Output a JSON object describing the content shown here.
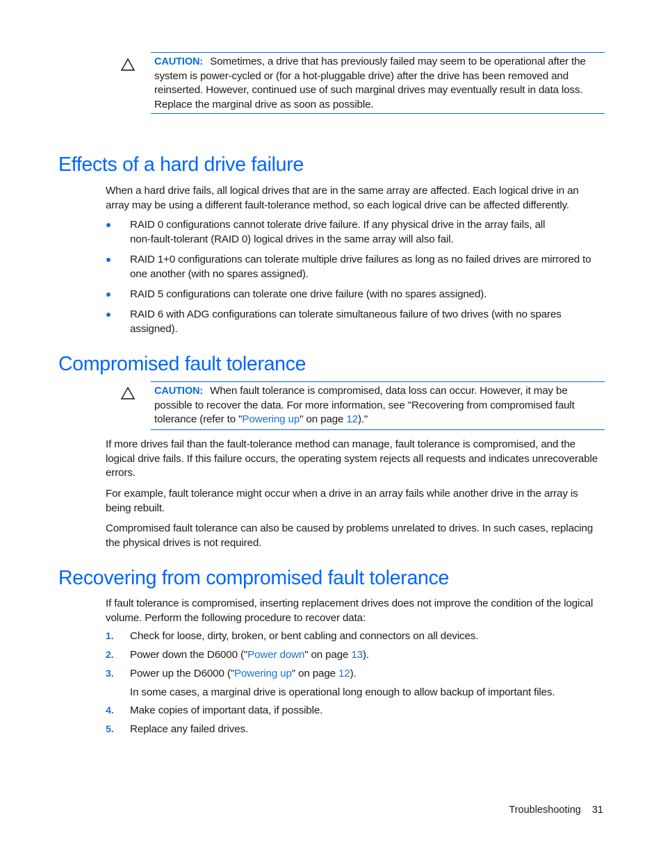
{
  "caution1": {
    "label": "CAUTION:",
    "text": "Sometimes, a drive that has previously failed may seem to be operational after the system is power-cycled or (for a hot-pluggable drive) after the drive has been removed and reinserted. However, continued use of such marginal drives may eventually result in data loss. Replace the marginal drive as soon as possible.",
    "lines": [
      "Sometimes, a drive that has previously failed may seem to be operational after the",
      "system is power-cycled or (for a hot-pluggable drive) after the drive has been removed and",
      "reinserted. However, continued use of such marginal drives may eventually result in data loss.",
      "Replace the marginal drive as soon as possible."
    ]
  },
  "section1": {
    "title": "Effects of a hard drive failure",
    "intro_lines": [
      "When a hard drive fails, all logical drives that are in the same array are affected. Each logical drive in an",
      "array may be using a different fault-tolerance method, so each logical drive can be affected differently."
    ],
    "bullets": [
      {
        "lines": [
          "RAID 0 configurations cannot tolerate drive failure. If any physical drive in the array fails, all",
          "non-fault-tolerant (RAID 0) logical drives in the same array will also fail."
        ]
      },
      {
        "lines": [
          "RAID 1+0 configurations can tolerate multiple drive failures as long as no failed drives are mirrored to",
          "one another (with no spares assigned)."
        ]
      },
      {
        "lines": [
          "RAID 5 configurations can tolerate one drive failure (with no spares assigned)."
        ]
      },
      {
        "lines": [
          "RAID 6 with ADG configurations can tolerate simultaneous failure of two drives (with no spares",
          "assigned)."
        ]
      }
    ]
  },
  "section2": {
    "title": "Compromised fault tolerance",
    "caution": {
      "label": "CAUTION:",
      "line1": "When fault tolerance is compromised, data loss can occur. However, it may be",
      "line2": "possible to recover the data. For more information, see \"Recovering from compromised fault",
      "line3_pre": "tolerance (refer to \"",
      "line3_link": "Powering up",
      "line3_mid": "\" on page ",
      "line3_page": "12",
      "line3_post": ").\""
    },
    "paragraphs": [
      [
        "If more drives fail than the fault-tolerance method can manage, fault tolerance is compromised, and the",
        "logical drive fails. If this failure occurs, the operating system rejects all requests and indicates unrecoverable",
        "errors."
      ],
      [
        "For example, fault tolerance might occur when a drive in an array fails while another drive in the array is",
        "being rebuilt."
      ],
      [
        "Compromised fault tolerance can also be caused by problems unrelated to drives. In such cases, replacing",
        "the physical drives is not required."
      ]
    ]
  },
  "section3": {
    "title": "Recovering from compromised fault tolerance",
    "intro_lines": [
      "If fault tolerance is compromised, inserting replacement drives does not improve the condition of the logical",
      "volume. Perform the following procedure to recover data:"
    ],
    "steps": [
      {
        "num": "1.",
        "text": "Check for loose, dirty, broken, or bent cabling and connectors on all devices."
      },
      {
        "num": "2.",
        "pre": "Power down the D6000 (\"",
        "link": "Power down",
        "mid": "\" on page ",
        "page": "13",
        "post": ")."
      },
      {
        "num": "3.",
        "pre": "Power up the D6000 (\"",
        "link": "Powering up",
        "mid": "\" on page ",
        "page": "12",
        "post": ")."
      },
      {
        "num": "4.",
        "text": "Make copies of important data, if possible."
      },
      {
        "num": "5.",
        "text": "Replace any failed drives."
      }
    ],
    "step3_note": "In some cases, a marginal drive is operational long enough to allow backup of important files."
  },
  "footer": {
    "section": "Troubleshooting",
    "page": "31"
  }
}
